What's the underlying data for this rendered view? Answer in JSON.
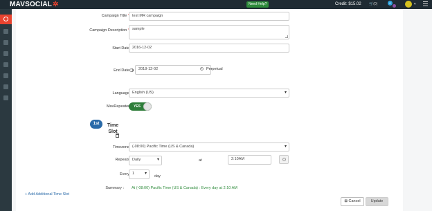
{
  "topbar": {
    "logo": "MAVSOCIAL",
    "help_button": "Need Help?",
    "credit": "Credit: $15.02",
    "cart_count": "(0)",
    "notifications_count": "0"
  },
  "form": {
    "campaign_title": {
      "label": "Campaign Title",
      "value": "test MR campaign"
    },
    "campaign_description": {
      "label": "Campaign Description",
      "value": "sample"
    },
    "start_date": {
      "label": "Start Date",
      "value": "2016-12-02"
    },
    "end_date": {
      "label": "End Date",
      "value": "2018-12-02",
      "perpetual_label": "Perpetual"
    },
    "language": {
      "label": "Language",
      "value": "English (US)"
    },
    "mavrepeater": {
      "label": "MavRepeater",
      "toggle_text": "YES"
    },
    "time_slot": {
      "badge": "1st",
      "title_line1": "Time",
      "title_line2": "Slot",
      "timezone_label": "Timezone",
      "timezone_value": "(-08:00) Pacific Time (US & Canada)",
      "repeats_label": "Repeats",
      "repeats_value": "Daily",
      "at_label": "at",
      "time_value": "2:10AM",
      "every_label": "Every",
      "every_value": "1",
      "every_unit": "day",
      "summary_label": "Summary :",
      "summary_value": "At (-08:00) Pacific Time (US & Canada) : Every day at 2:10 AM"
    },
    "add_slot_link": "+ Add Additional Time Slot",
    "cancel_button": "Cancel",
    "update_button": "Update"
  },
  "colors": {
    "accent": "#e8432f",
    "topbar": "#1f2b33",
    "sidebar": "#2b3940",
    "toggle_on": "#2e7d3a",
    "summary_text": "#2e8b3b",
    "link": "#2a6aa8"
  },
  "sidebar_icons": [
    "dashboard-icon",
    "edit-icon",
    "tag-icon",
    "inbox-icon",
    "analytics-icon",
    "settings-icon",
    "users-icon",
    "help-icon"
  ]
}
